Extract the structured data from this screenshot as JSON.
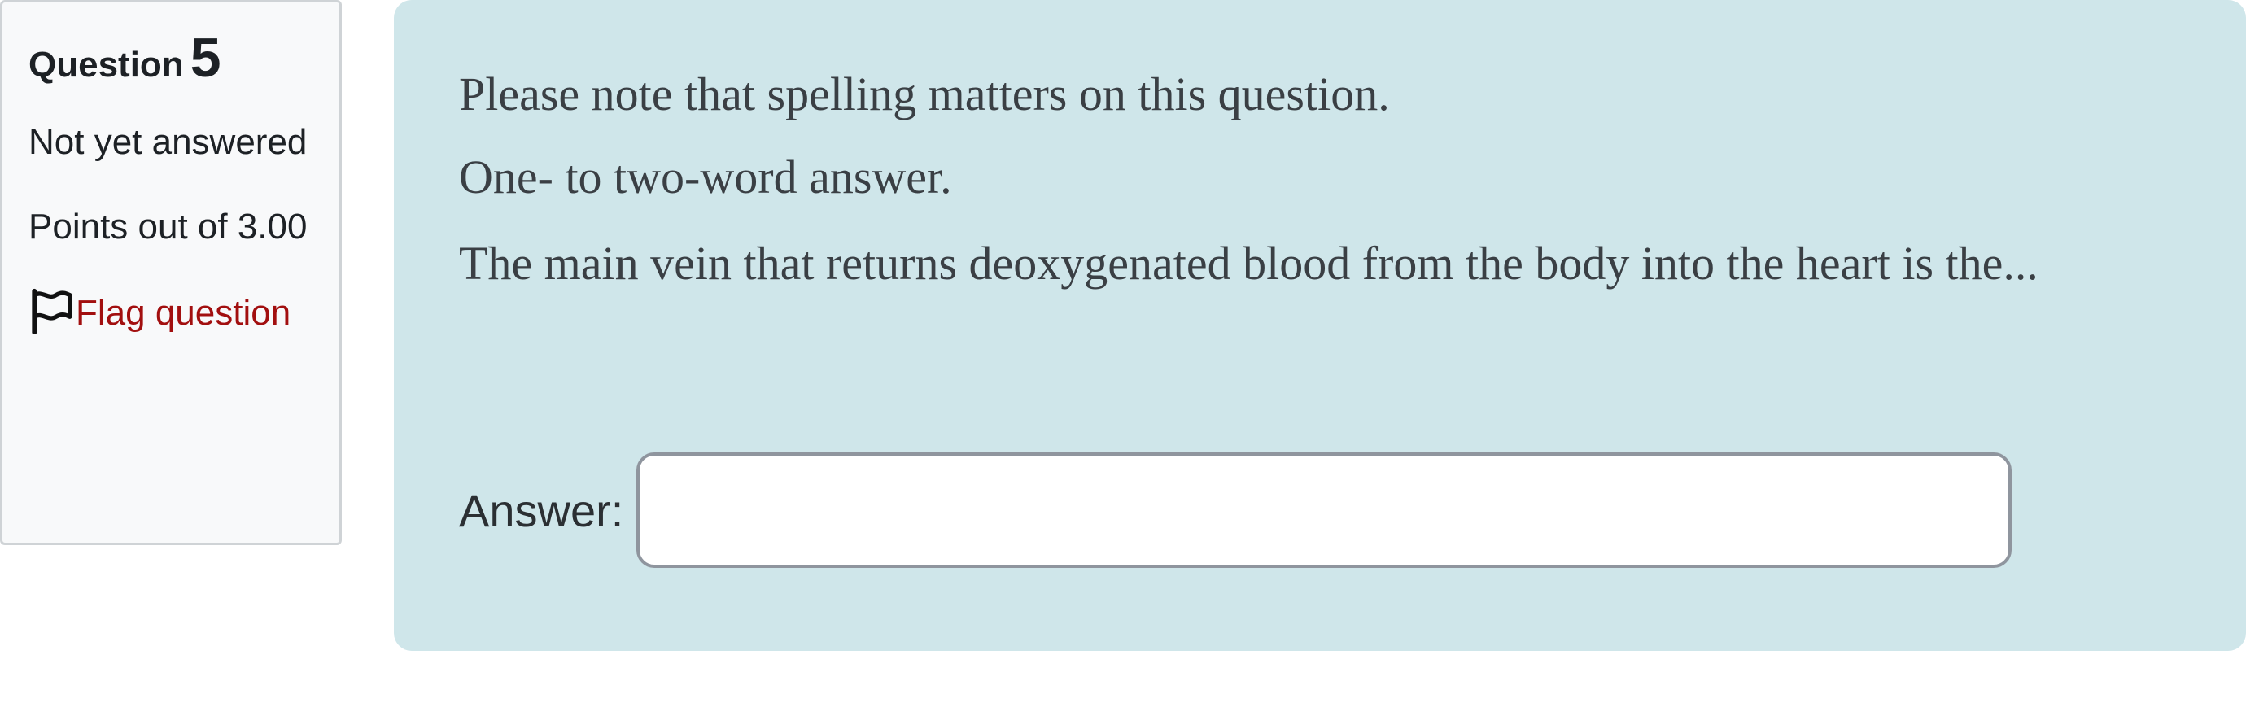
{
  "question_info": {
    "label": "Question",
    "number": "5",
    "state": "Not yet answered",
    "grade": "Points out of 3.00",
    "flag_label": "Flag question",
    "flag_icon": "flag-outline-icon"
  },
  "question_content": {
    "paragraphs": [
      "Please note that spelling matters on this question.",
      "One- to two-word answer.",
      "The main vein that returns deoxygenated blood from the body into the heart is the..."
    ],
    "answer_label": "Answer:",
    "answer_value": "",
    "answer_placeholder": ""
  },
  "colors": {
    "content_background": "#cfe6ea",
    "info_background": "#f8f9fa",
    "flag_link": "#a20f0f"
  }
}
